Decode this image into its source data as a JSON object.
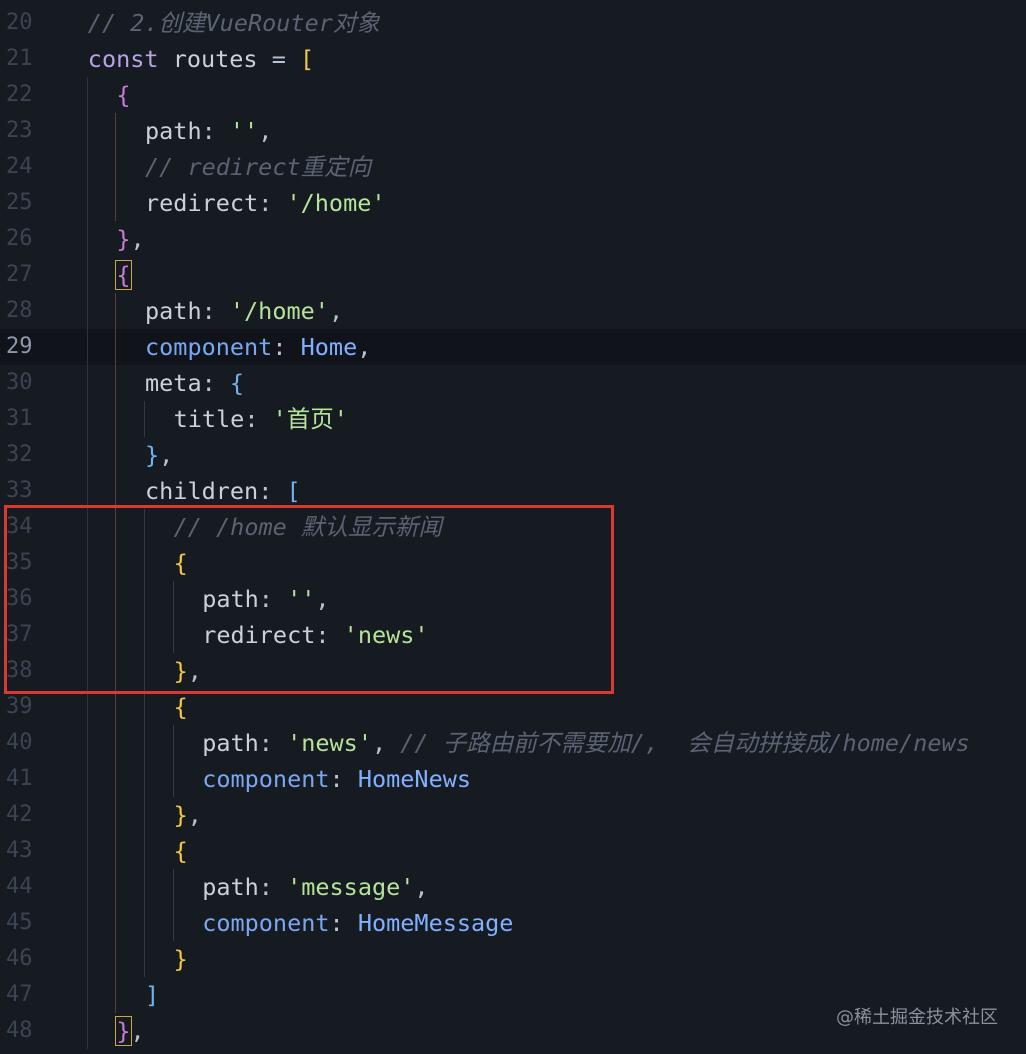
{
  "editor": {
    "current_line": 29,
    "lines": [
      {
        "num": "20",
        "tokens": [
          {
            "t": "// 2.创建VueRouter对象",
            "c": "t-cmt"
          }
        ],
        "indent": 3
      },
      {
        "num": "21",
        "tokens": [
          {
            "t": "const",
            "c": "t-kw"
          },
          {
            "t": " routes ",
            "c": "t-var"
          },
          {
            "t": "=",
            "c": "t-op"
          },
          {
            "t": " ",
            "c": "t-op"
          },
          {
            "t": "[",
            "c": "b1"
          }
        ],
        "indent": 3
      },
      {
        "num": "22",
        "tokens": [
          {
            "t": "{",
            "c": "b2"
          }
        ],
        "indent": 4
      },
      {
        "num": "23",
        "tokens": [
          {
            "t": "path",
            "c": "t-prop"
          },
          {
            "t": ": ",
            "c": "t-punct"
          },
          {
            "t": "''",
            "c": "t-str"
          },
          {
            "t": ",",
            "c": "t-punct"
          }
        ],
        "indent": 5
      },
      {
        "num": "24",
        "tokens": [
          {
            "t": "// redirect重定向",
            "c": "t-cmt"
          }
        ],
        "indent": 5
      },
      {
        "num": "25",
        "tokens": [
          {
            "t": "redirect",
            "c": "t-prop"
          },
          {
            "t": ": ",
            "c": "t-punct"
          },
          {
            "t": "'/home'",
            "c": "t-str"
          }
        ],
        "indent": 5
      },
      {
        "num": "26",
        "tokens": [
          {
            "t": "}",
            "c": "b2"
          },
          {
            "t": ",",
            "c": "t-punct"
          }
        ],
        "indent": 4
      },
      {
        "num": "27",
        "tokens": [
          {
            "t": "{",
            "c": "b2",
            "box": true
          }
        ],
        "indent": 4
      },
      {
        "num": "28",
        "tokens": [
          {
            "t": "path",
            "c": "t-prop"
          },
          {
            "t": ": ",
            "c": "t-punct"
          },
          {
            "t": "'/home'",
            "c": "t-str"
          },
          {
            "t": ",",
            "c": "t-punct"
          }
        ],
        "indent": 5
      },
      {
        "num": "29",
        "tokens": [
          {
            "t": "component",
            "c": "t-prop-blue"
          },
          {
            "t": ": ",
            "c": "t-punct"
          },
          {
            "t": "Home",
            "c": "t-comp"
          },
          {
            "t": ",",
            "c": "t-punct"
          }
        ],
        "indent": 5
      },
      {
        "num": "30",
        "tokens": [
          {
            "t": "meta",
            "c": "t-prop"
          },
          {
            "t": ": ",
            "c": "t-punct"
          },
          {
            "t": "{",
            "c": "b3"
          }
        ],
        "indent": 5
      },
      {
        "num": "31",
        "tokens": [
          {
            "t": "title",
            "c": "t-prop"
          },
          {
            "t": ": ",
            "c": "t-punct"
          },
          {
            "t": "'首页'",
            "c": "t-str"
          }
        ],
        "indent": 6
      },
      {
        "num": "32",
        "tokens": [
          {
            "t": "}",
            "c": "b3"
          },
          {
            "t": ",",
            "c": "t-punct"
          }
        ],
        "indent": 5
      },
      {
        "num": "33",
        "tokens": [
          {
            "t": "children",
            "c": "t-prop"
          },
          {
            "t": ": ",
            "c": "t-punct"
          },
          {
            "t": "[",
            "c": "b3"
          }
        ],
        "indent": 5
      },
      {
        "num": "34",
        "tokens": [
          {
            "t": "// /home 默认显示新闻",
            "c": "t-cmt"
          }
        ],
        "indent": 6
      },
      {
        "num": "35",
        "tokens": [
          {
            "t": "{",
            "c": "b1"
          }
        ],
        "indent": 6
      },
      {
        "num": "36",
        "tokens": [
          {
            "t": "path",
            "c": "t-prop"
          },
          {
            "t": ": ",
            "c": "t-punct"
          },
          {
            "t": "''",
            "c": "t-str"
          },
          {
            "t": ",",
            "c": "t-punct"
          }
        ],
        "indent": 7
      },
      {
        "num": "37",
        "tokens": [
          {
            "t": "redirect",
            "c": "t-prop"
          },
          {
            "t": ": ",
            "c": "t-punct"
          },
          {
            "t": "'news'",
            "c": "t-str"
          }
        ],
        "indent": 7
      },
      {
        "num": "38",
        "tokens": [
          {
            "t": "}",
            "c": "b1"
          },
          {
            "t": ",",
            "c": "t-punct"
          }
        ],
        "indent": 6
      },
      {
        "num": "39",
        "tokens": [
          {
            "t": "{",
            "c": "b1"
          }
        ],
        "indent": 6
      },
      {
        "num": "40",
        "tokens": [
          {
            "t": "path",
            "c": "t-prop"
          },
          {
            "t": ": ",
            "c": "t-punct"
          },
          {
            "t": "'news'",
            "c": "t-str"
          },
          {
            "t": ", ",
            "c": "t-punct"
          },
          {
            "t": "// 子路由前不需要加/,  会自动拼接成/home/news",
            "c": "t-cmt"
          }
        ],
        "indent": 7
      },
      {
        "num": "41",
        "tokens": [
          {
            "t": "component",
            "c": "t-prop-blue"
          },
          {
            "t": ": ",
            "c": "t-punct"
          },
          {
            "t": "HomeNews",
            "c": "t-comp"
          }
        ],
        "indent": 7
      },
      {
        "num": "42",
        "tokens": [
          {
            "t": "}",
            "c": "b1"
          },
          {
            "t": ",",
            "c": "t-punct"
          }
        ],
        "indent": 6
      },
      {
        "num": "43",
        "tokens": [
          {
            "t": "{",
            "c": "b1"
          }
        ],
        "indent": 6
      },
      {
        "num": "44",
        "tokens": [
          {
            "t": "path",
            "c": "t-prop"
          },
          {
            "t": ": ",
            "c": "t-punct"
          },
          {
            "t": "'message'",
            "c": "t-str"
          },
          {
            "t": ",",
            "c": "t-punct"
          }
        ],
        "indent": 7
      },
      {
        "num": "45",
        "tokens": [
          {
            "t": "component",
            "c": "t-prop-blue"
          },
          {
            "t": ": ",
            "c": "t-punct"
          },
          {
            "t": "HomeMessage",
            "c": "t-comp"
          }
        ],
        "indent": 7
      },
      {
        "num": "46",
        "tokens": [
          {
            "t": "}",
            "c": "b1"
          }
        ],
        "indent": 6
      },
      {
        "num": "47",
        "tokens": [
          {
            "t": "]",
            "c": "b3"
          }
        ],
        "indent": 5
      },
      {
        "num": "48",
        "tokens": [
          {
            "t": "}",
            "c": "b2",
            "box": true
          },
          {
            "t": ",",
            "c": "t-punct"
          }
        ],
        "indent": 4
      }
    ]
  },
  "watermark": "@稀土掘金技术社区",
  "colors": {
    "background": "#161a21",
    "highlight_box": "#d63a31",
    "string": "#b6e39a",
    "comment": "#5a6373",
    "keyword": "#b7a3e6"
  }
}
